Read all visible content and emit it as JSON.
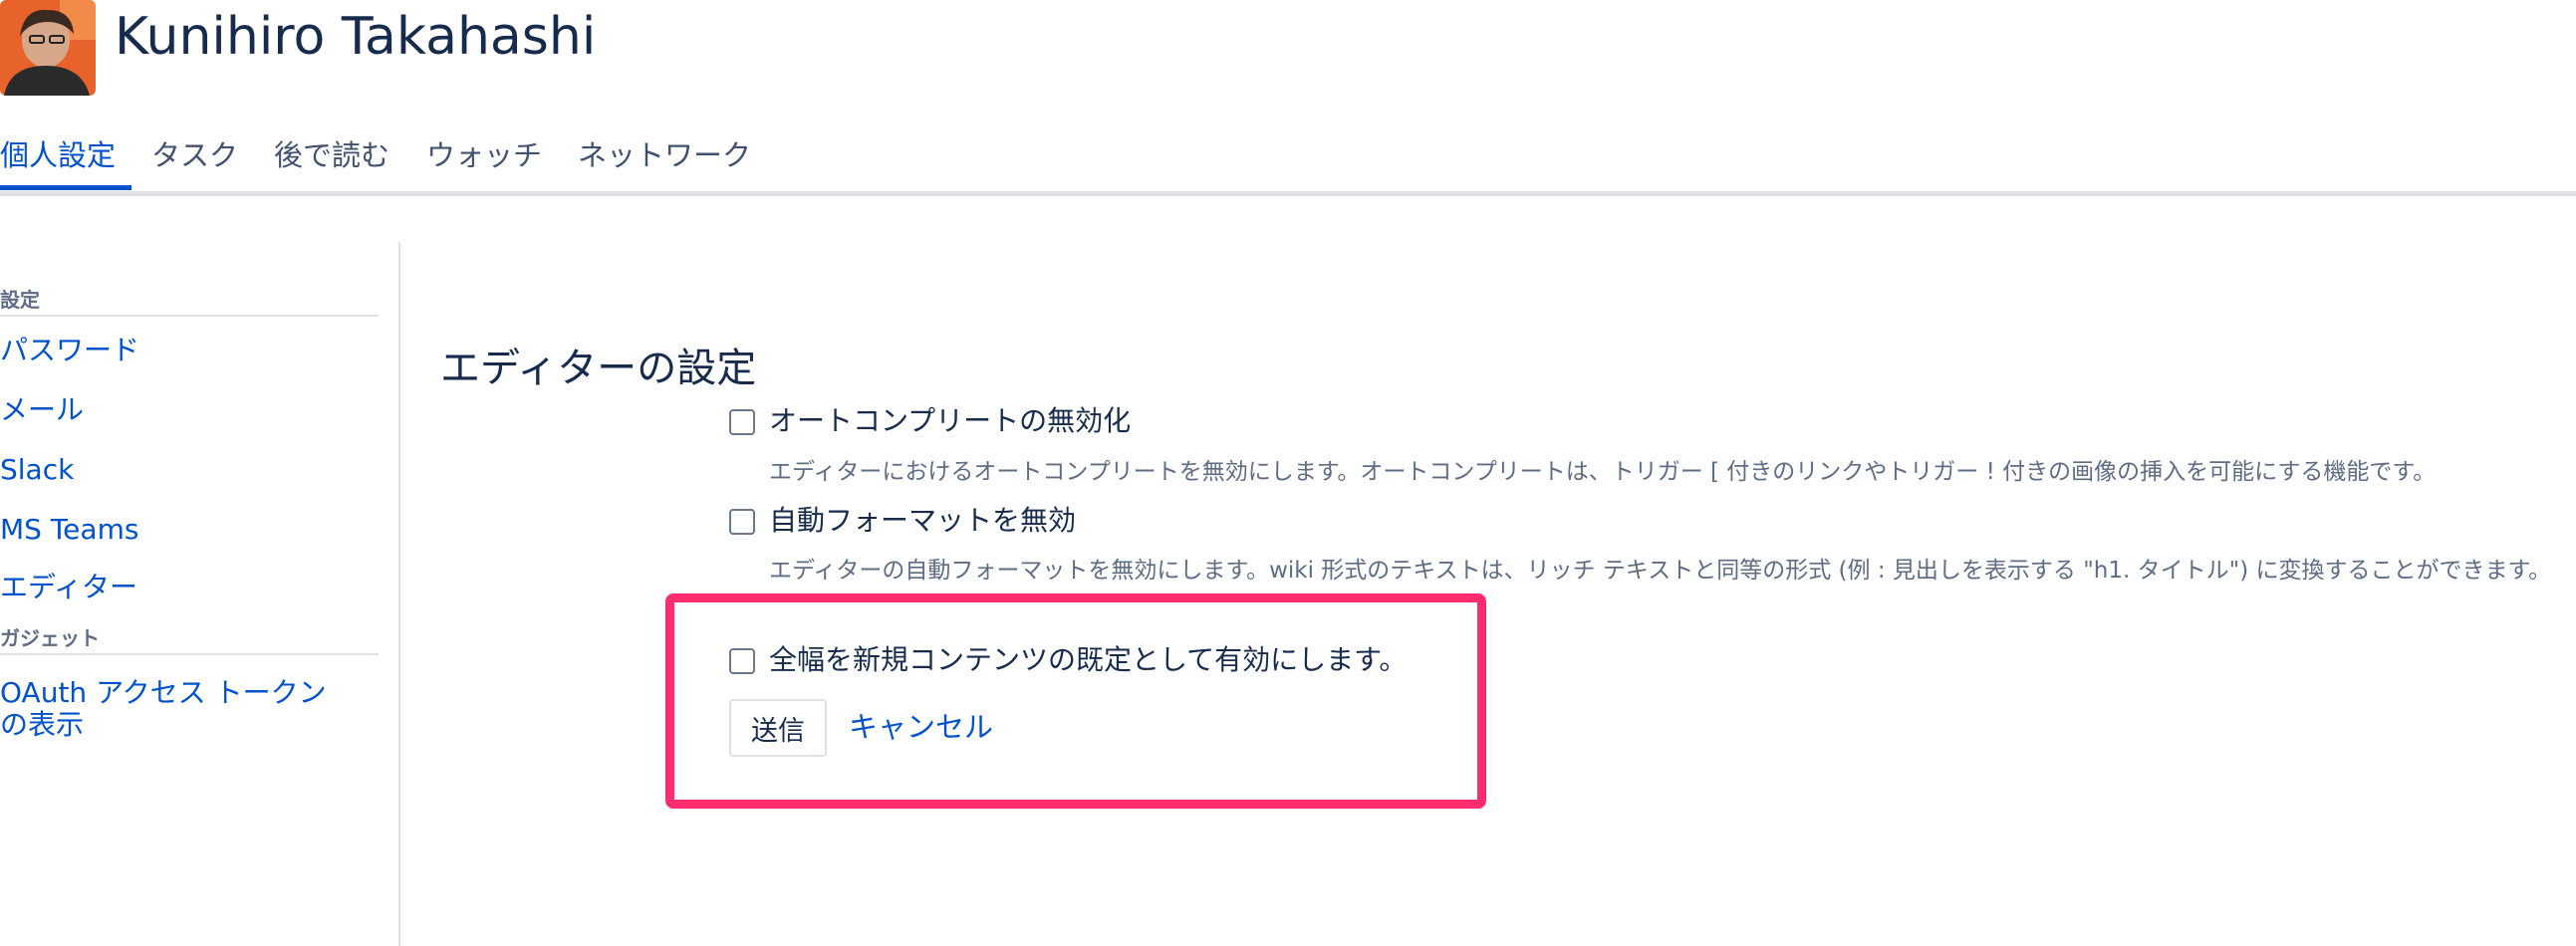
{
  "profile": {
    "name": "Kunihiro Takahashi"
  },
  "tabs": [
    {
      "label": "個人設定",
      "active": true
    },
    {
      "label": "タスク",
      "active": false
    },
    {
      "label": "後で読む",
      "active": false
    },
    {
      "label": "ウォッチ",
      "active": false
    },
    {
      "label": "ネットワーク",
      "active": false
    }
  ],
  "sidebar": {
    "settings_heading": "設定",
    "settings_items": [
      {
        "label": "パスワード"
      },
      {
        "label": "メール"
      },
      {
        "label": "Slack"
      },
      {
        "label": "MS Teams"
      },
      {
        "label": "エディター"
      }
    ],
    "gadgets_heading": "ガジェット",
    "gadget_items": [
      {
        "label": "OAuth アクセス トークンの表示"
      }
    ]
  },
  "main": {
    "title": "エディターの設定",
    "options": [
      {
        "label": "オートコンプリートの無効化",
        "description": "エディターにおけるオートコンプリートを無効にします。オートコンプリートは、トリガー [ 付きのリンクやトリガー ! 付きの画像の挿入を可能にする機能です。",
        "checked": false
      },
      {
        "label": "自動フォーマットを無効",
        "description": "エディターの自動フォーマットを無効にします。wiki 形式のテキストは、リッチ テキストと同等の形式 (例 : 見出しを表示する \"h1. タイトル\") に変換することができます。",
        "checked": false
      },
      {
        "label": "全幅を新規コンテンツの既定として有効にします。",
        "description": "",
        "checked": false
      }
    ],
    "submit_label": "送信",
    "cancel_label": "キャンセル"
  },
  "colors": {
    "link": "#0052cc",
    "highlight": "#ff2d6f",
    "text": "#172b4d",
    "muted": "#5e6c84"
  }
}
